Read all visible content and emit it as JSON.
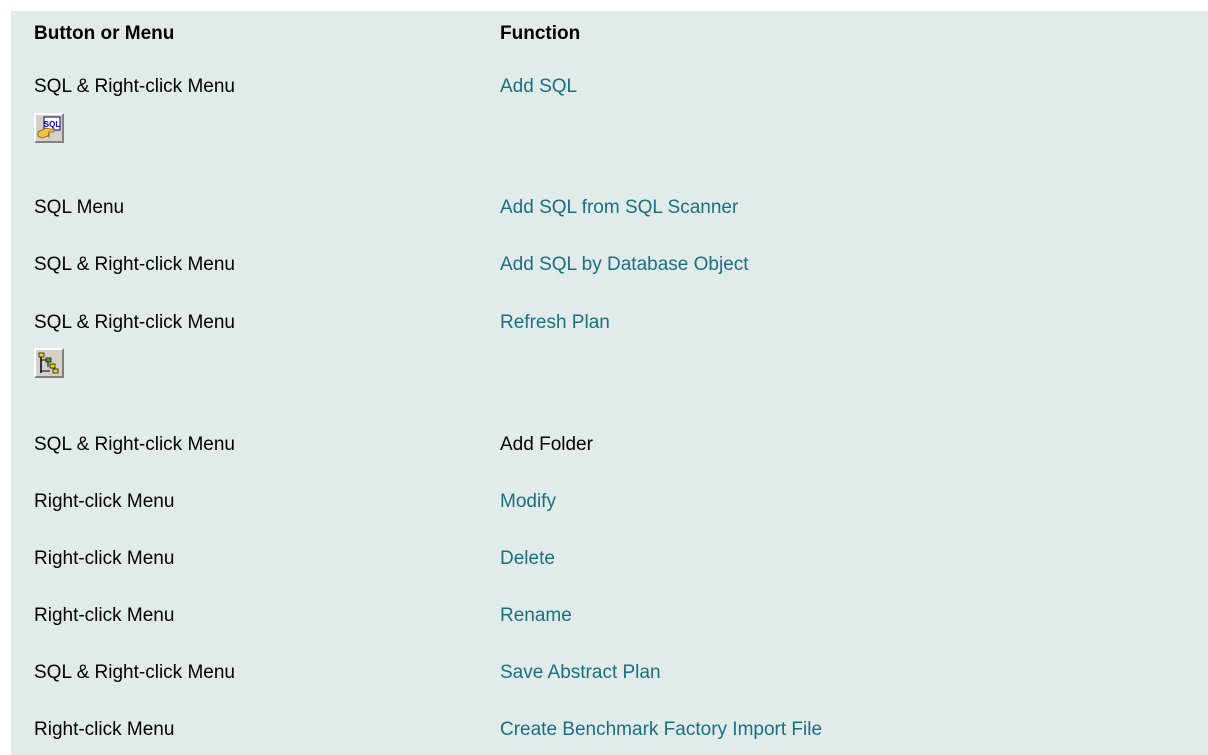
{
  "header": {
    "col1": "Button or Menu",
    "col2": "Function"
  },
  "rows": [
    {
      "source": "SQL & Right-click Menu",
      "function": "Add SQL",
      "link": true,
      "icon": "add-sql-icon"
    },
    {
      "source": "SQL Menu",
      "function": "Add SQL from SQL Scanner",
      "link": true
    },
    {
      "source": "SQL & Right-click Menu",
      "function": "Add SQL by Database Object",
      "link": true
    },
    {
      "source": "SQL & Right-click Menu",
      "function": "Refresh Plan",
      "link": true,
      "icon": "refresh-plan-icon"
    },
    {
      "source": "SQL & Right-click Menu",
      "function": "Add Folder",
      "link": false
    },
    {
      "source": "Right-click Menu",
      "function": "Modify",
      "link": true
    },
    {
      "source": "Right-click Menu",
      "function": "Delete",
      "link": true
    },
    {
      "source": "Right-click Menu",
      "function": "Rename",
      "link": true
    },
    {
      "source": "SQL & Right-click Menu",
      "function": "Save Abstract Plan",
      "link": true
    },
    {
      "source": "Right-click Menu",
      "function": "Create Benchmark Factory Import File",
      "link": true
    }
  ],
  "icons": {
    "add_sql_text": "SQL"
  },
  "colors": {
    "background": "#e1ebea",
    "link": "#1a7080",
    "text": "#000000"
  }
}
